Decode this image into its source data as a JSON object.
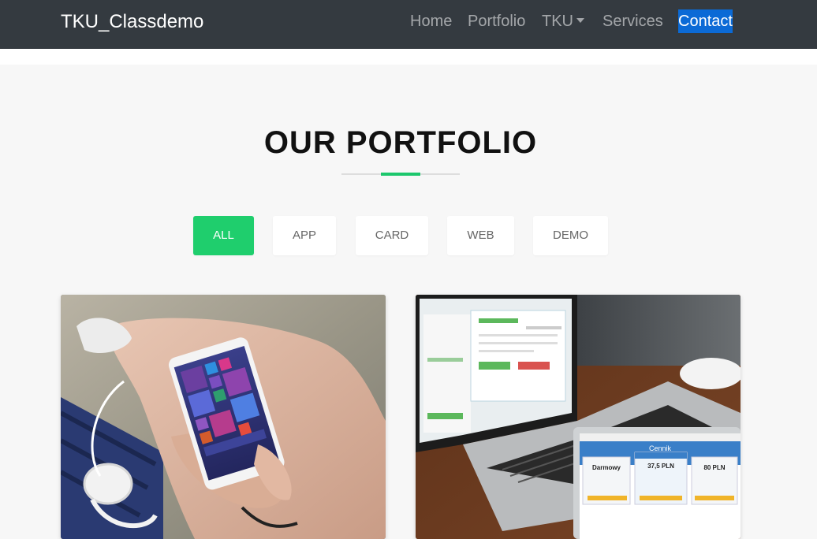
{
  "navbar": {
    "brand": "TKU_Classdemo",
    "items": [
      {
        "label": "Home"
      },
      {
        "label": "Portfolio"
      },
      {
        "label": "TKU"
      },
      {
        "label": "Services"
      },
      {
        "label": "Contact"
      }
    ]
  },
  "portfolio": {
    "title": "OUR PORTFOLIO",
    "filters": [
      "ALL",
      "APP",
      "CARD",
      "WEB",
      "DEMO"
    ],
    "active_filter": "ALL"
  },
  "laptop_screen": {
    "title": "Cennik",
    "plan_free_name": "Darmowy",
    "plan_mid_price": "37,5 PLN",
    "plan_top_price": "80 PLN"
  },
  "colors": {
    "navbar_bg": "#343a40",
    "accent": "#1fce6d",
    "contact_highlight": "#0b6ad6"
  }
}
